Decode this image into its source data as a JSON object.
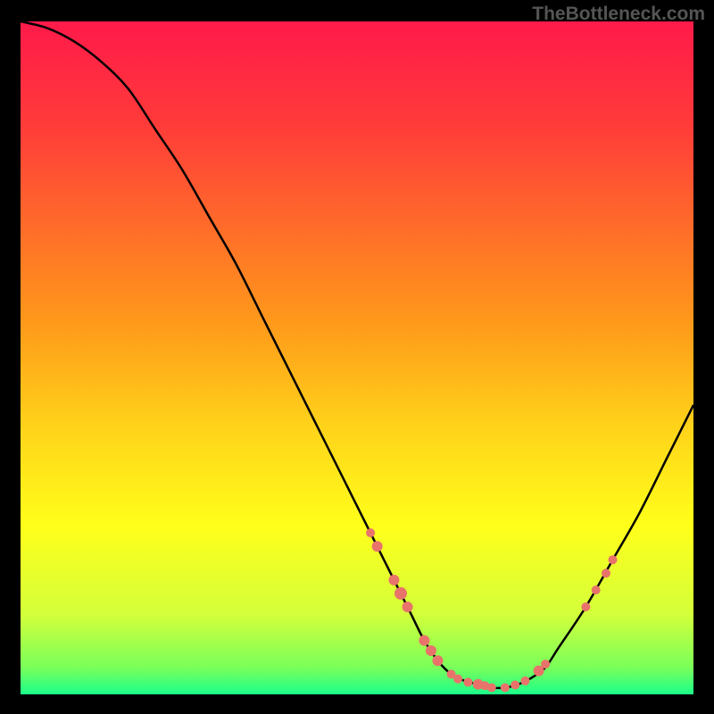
{
  "watermark": "TheBottleneck.com",
  "chart_data": {
    "type": "line",
    "title": "",
    "xlabel": "",
    "ylabel": "",
    "xlim": [
      0,
      100
    ],
    "ylim": [
      0,
      100
    ],
    "grid": false,
    "legend": false,
    "gradient_stops": [
      {
        "pos": 0.0,
        "color": "#ff1a4a"
      },
      {
        "pos": 0.15,
        "color": "#ff3a3a"
      },
      {
        "pos": 0.3,
        "color": "#ff6a2a"
      },
      {
        "pos": 0.45,
        "color": "#ff9a1a"
      },
      {
        "pos": 0.6,
        "color": "#ffd21a"
      },
      {
        "pos": 0.75,
        "color": "#ffff1a"
      },
      {
        "pos": 0.88,
        "color": "#d4ff3a"
      },
      {
        "pos": 0.96,
        "color": "#7aff5a"
      },
      {
        "pos": 1.0,
        "color": "#1aff8a"
      }
    ],
    "series": [
      {
        "name": "bottleneck-curve",
        "color": "#000000",
        "x": [
          0,
          4,
          8,
          12,
          16,
          20,
          24,
          28,
          32,
          36,
          40,
          44,
          48,
          52,
          55,
          58,
          60,
          62,
          64,
          66,
          68,
          70,
          72,
          74,
          76,
          78,
          80,
          84,
          88,
          92,
          96,
          100
        ],
        "y": [
          100,
          99,
          97,
          94,
          90,
          84,
          78,
          71,
          64,
          56,
          48,
          40,
          32,
          24,
          18,
          12,
          8,
          5,
          3,
          2,
          1.5,
          1,
          1,
          1.5,
          2.5,
          4,
          7,
          13,
          20,
          27,
          35,
          43
        ]
      }
    ],
    "markers": [
      {
        "x": 52,
        "y": 24,
        "r": 5
      },
      {
        "x": 53,
        "y": 22,
        "r": 6
      },
      {
        "x": 55.5,
        "y": 17,
        "r": 6
      },
      {
        "x": 56.5,
        "y": 15,
        "r": 7
      },
      {
        "x": 57.5,
        "y": 13,
        "r": 6
      },
      {
        "x": 60,
        "y": 8,
        "r": 6
      },
      {
        "x": 61,
        "y": 6.5,
        "r": 6
      },
      {
        "x": 62,
        "y": 5,
        "r": 6
      },
      {
        "x": 64,
        "y": 3,
        "r": 5
      },
      {
        "x": 65,
        "y": 2.3,
        "r": 5
      },
      {
        "x": 66.5,
        "y": 1.8,
        "r": 5
      },
      {
        "x": 68,
        "y": 1.5,
        "r": 6
      },
      {
        "x": 69,
        "y": 1.3,
        "r": 5
      },
      {
        "x": 70,
        "y": 1,
        "r": 5
      },
      {
        "x": 72,
        "y": 1,
        "r": 5
      },
      {
        "x": 73.5,
        "y": 1.4,
        "r": 5
      },
      {
        "x": 75,
        "y": 2,
        "r": 5
      },
      {
        "x": 77,
        "y": 3.5,
        "r": 6
      },
      {
        "x": 78,
        "y": 4.5,
        "r": 5
      },
      {
        "x": 84,
        "y": 13,
        "r": 5
      },
      {
        "x": 85.5,
        "y": 15.5,
        "r": 5
      },
      {
        "x": 87,
        "y": 18,
        "r": 5
      },
      {
        "x": 88,
        "y": 20,
        "r": 5
      }
    ],
    "marker_color": "#e8736b"
  }
}
